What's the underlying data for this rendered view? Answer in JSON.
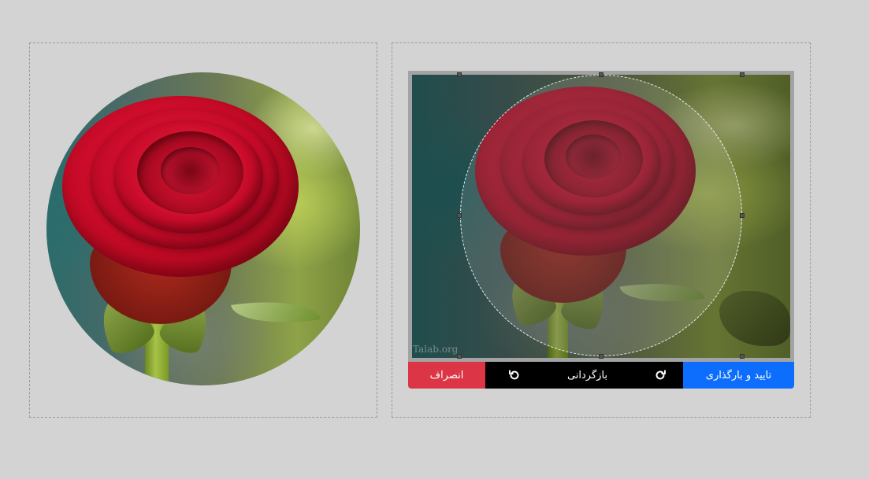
{
  "editor": {
    "watermark": "Talab.org",
    "toolbar": {
      "cancel_label": "انصراف",
      "reset_label": "بازگردانی",
      "confirm_label": "تایید و بارگذاری",
      "rotate_left_icon": "rotate-counterclockwise-icon",
      "rotate_right_icon": "rotate-clockwise-icon"
    }
  },
  "colors": {
    "background": "#d3d3d3",
    "cancel": "#dc3545",
    "reset_bar": "#000000",
    "confirm": "#0d6efd"
  }
}
